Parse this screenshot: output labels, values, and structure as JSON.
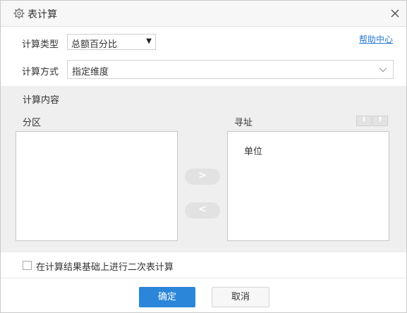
{
  "dialog": {
    "title": "表计算",
    "icon": "gear-icon",
    "close_icon": "close-icon"
  },
  "form": {
    "calc_type_label": "计算类型",
    "calc_type_value": "总额百分比",
    "calc_method_label": "计算方式",
    "calc_method_value": "指定维度",
    "help_link": "帮助中心"
  },
  "content": {
    "section_title": "计算内容",
    "partition_label": "分区",
    "addressing_label": "寻址",
    "partition_items": [],
    "addressing_items": [
      "单位"
    ],
    "move_right_symbol": ">",
    "move_left_symbol": "<",
    "sort_down_symbol": "⬇",
    "sort_up_symbol": "⬆"
  },
  "secondary": {
    "label": "在计算结果基础上进行二次表计算",
    "checked": false
  },
  "buttons": {
    "ok": "确定",
    "cancel": "取消"
  },
  "colors": {
    "primary": "#2b86d9",
    "link": "#2a7ad1",
    "panel_bg": "#efefef"
  }
}
